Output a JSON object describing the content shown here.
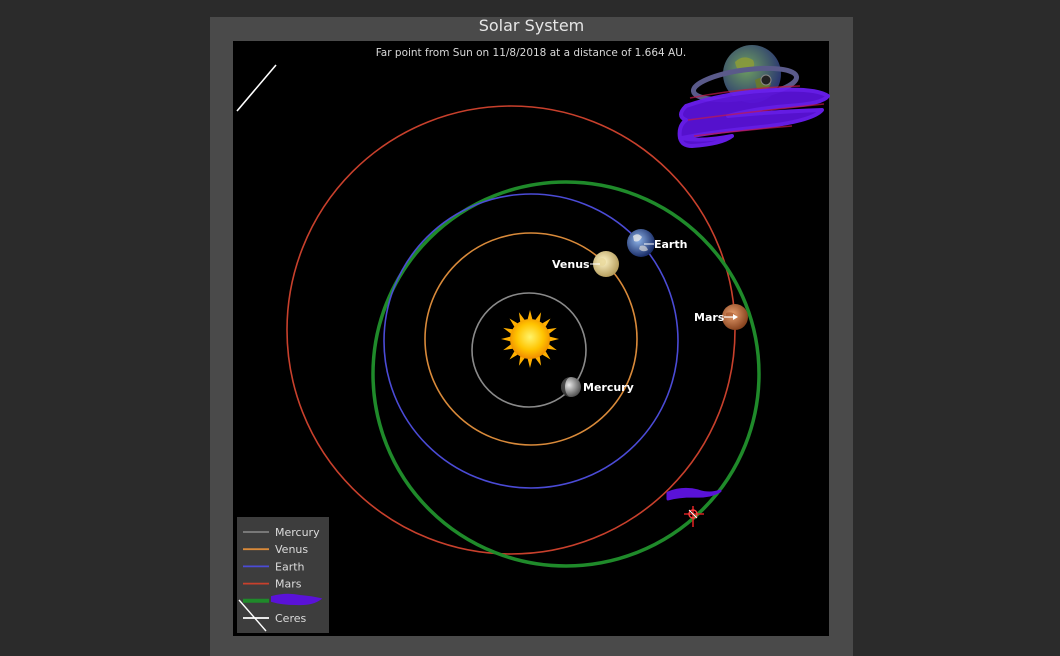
{
  "window": {
    "title": "Solar System"
  },
  "plot": {
    "subtitle": "Far point from Sun on 11/8/2018 at a distance of 1.664 AU."
  },
  "planets": [
    {
      "key": "mercury",
      "label": "Mercury",
      "color": "#808080"
    },
    {
      "key": "venus",
      "label": "Venus",
      "color": "#d98a3a"
    },
    {
      "key": "earth",
      "label": "Earth",
      "color": "#4b4bd6"
    },
    {
      "key": "mars",
      "label": "Mars",
      "color": "#c8402c"
    }
  ],
  "legend": {
    "items": [
      {
        "label": "Mercury",
        "color": "#808080"
      },
      {
        "label": "Venus",
        "color": "#d98a3a"
      },
      {
        "label": "Earth",
        "color": "#4b4bd6"
      },
      {
        "label": "Mars",
        "color": "#c8402c"
      },
      {
        "label": "",
        "color": "#1f8a2a"
      },
      {
        "label": "Ceres",
        "color": "#ffffff"
      }
    ]
  },
  "colors": {
    "target_orbit": "#1f8a2a",
    "scribble": "#5a12d8",
    "sun": "#ffc400"
  }
}
